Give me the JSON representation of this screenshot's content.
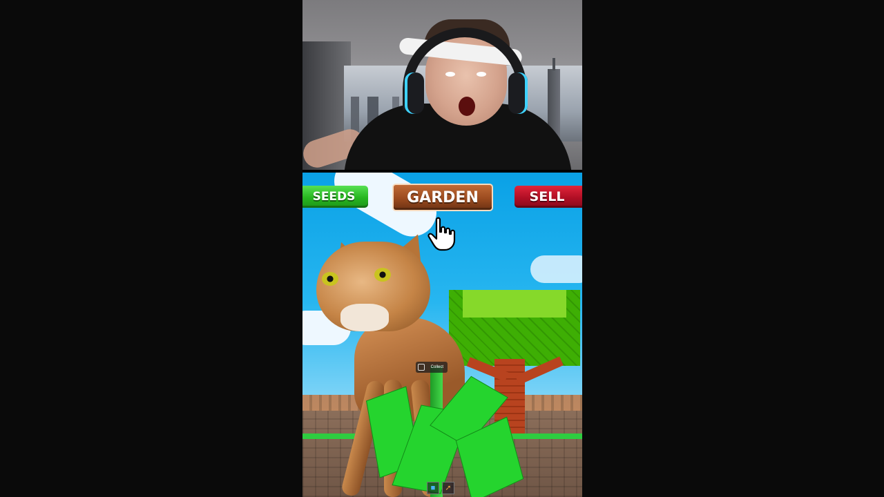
{
  "nav": {
    "seeds_label": "SEEDS",
    "garden_label": "GARDEN",
    "sell_label": "SELL"
  },
  "prompt": {
    "collect_label": "Collect"
  },
  "icons": {
    "cursor": "hand-pointer-icon",
    "collect": "collect-icon",
    "hotbar_1": "cube-icon",
    "hotbar_2": "tool-icon"
  },
  "colors": {
    "seeds": "#27b61f",
    "garden": "#9b4b1f",
    "sell": "#b10f25",
    "sky": "#0aa1e6",
    "foliage": "#7ed321"
  }
}
